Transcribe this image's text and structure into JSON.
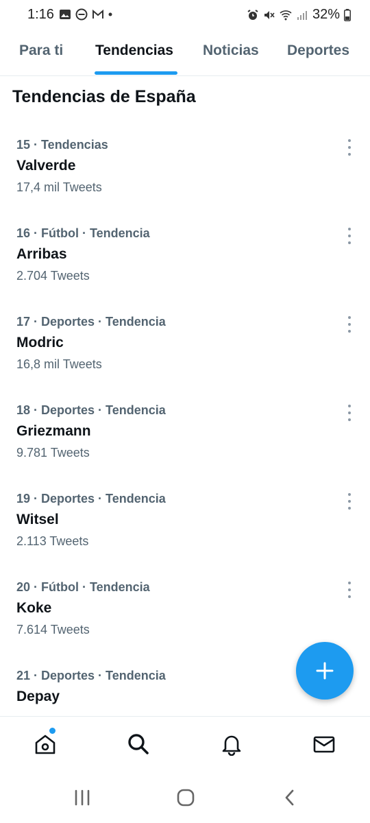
{
  "status_bar": {
    "time": "1:16",
    "battery": "32%"
  },
  "tabs": [
    {
      "label": "Para ti"
    },
    {
      "label": "Tendencias"
    },
    {
      "label": "Noticias"
    },
    {
      "label": "Deportes"
    }
  ],
  "section_title": "Tendencias de España",
  "trends": [
    {
      "meta": "15 · Tendencias",
      "name": "Valverde",
      "count": "17,4 mil Tweets"
    },
    {
      "meta": "16 · Fútbol · Tendencia",
      "name": "Arribas",
      "count": "2.704 Tweets"
    },
    {
      "meta": "17 · Deportes · Tendencia",
      "name": "Modric",
      "count": "16,8 mil Tweets"
    },
    {
      "meta": "18 · Deportes · Tendencia",
      "name": "Griezmann",
      "count": "9.781 Tweets"
    },
    {
      "meta": "19 · Deportes · Tendencia",
      "name": "Witsel",
      "count": "2.113 Tweets"
    },
    {
      "meta": "20 · Fútbol · Tendencia",
      "name": "Koke",
      "count": "7.614 Tweets"
    },
    {
      "meta": "21 · Deportes · Tendencia",
      "name": "Depay",
      "count": ""
    }
  ],
  "colors": {
    "accent": "#1d9bf0",
    "secondary_text": "#536471",
    "primary_text": "#0f1419"
  },
  "icons": {
    "fab": "plus-icon",
    "nav": [
      "home-icon",
      "search-icon",
      "bell-icon",
      "mail-icon"
    ],
    "system": [
      "recents-icon",
      "home-circle-icon",
      "back-icon"
    ]
  }
}
